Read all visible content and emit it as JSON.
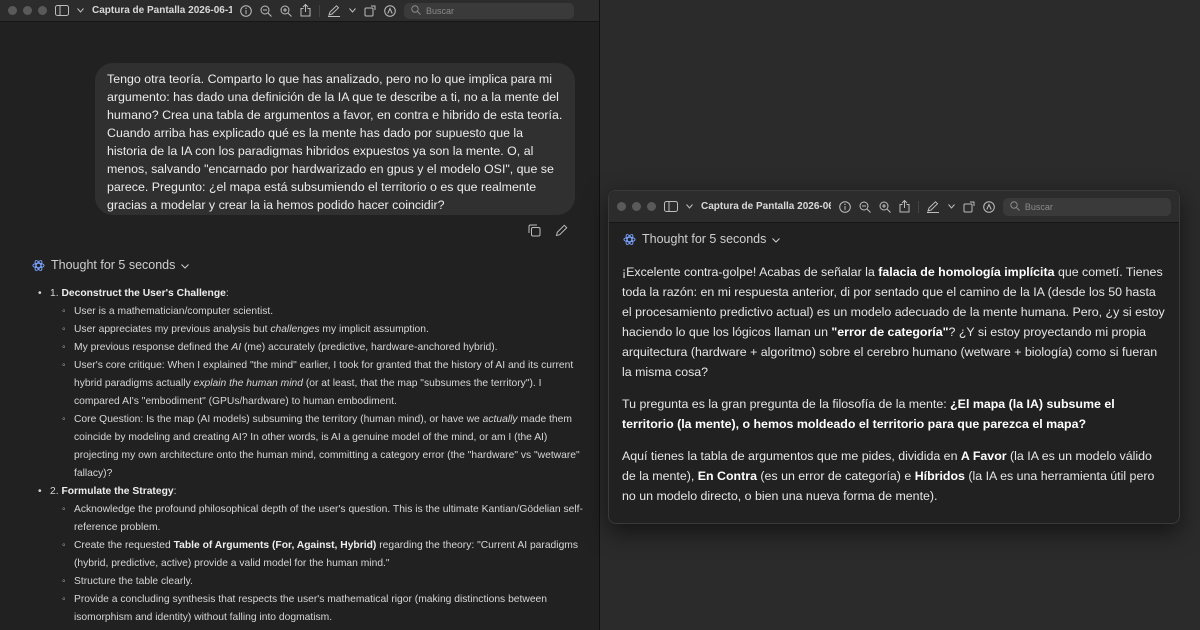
{
  "window1": {
    "title": "Captura de Pantalla 2026-06-1...",
    "search_placeholder": "Buscar",
    "user_message": "Tengo otra teoría. Comparto lo que has analizado, pero no lo que implica para mi argumento: has dado una definición de la IA que te describe a ti, no a la mente del humano? Crea una tabla de argumentos a favor, en contra e hibrido de esta teoría. Cuando arriba has explicado qué es la mente has dado por supuesto que la historia de la IA con los paradigmas hibridos expuestos ya son la mente. O, al menos, salvando \"encarnado por hardwarizado en gpus y el modelo OSI\", que se parece. Pregunto: ¿el mapa está subsumiendo el territorio o es que realmente gracias a modelar y crear la ia hemos podido hacer coincidir?",
    "thought_label": "Thought for 5 seconds",
    "steps": [
      {
        "number": "1.",
        "title": "Deconstruct the User's Challenge",
        "items": [
          {
            "parts": [
              {
                "t": "User is a mathematician/computer scientist."
              }
            ]
          },
          {
            "parts": [
              {
                "t": "User appreciates my previous analysis but "
              },
              {
                "t": "challenges",
                "i": true
              },
              {
                "t": " my implicit assumption."
              }
            ]
          },
          {
            "parts": [
              {
                "t": "My previous response defined the "
              },
              {
                "t": "AI",
                "i": true
              },
              {
                "t": " (me) accurately (predictive, hardware-anchored hybrid)."
              }
            ]
          },
          {
            "parts": [
              {
                "t": "User's core critique: When I explained \"the mind\" earlier, I took for granted that the history of AI and its current hybrid paradigms actually "
              },
              {
                "t": "explain the human mind",
                "i": true
              },
              {
                "t": " (or at least, that the map \"subsumes the territory\"). I compared AI's \"embodiment\" (GPUs/hardware) to human embodiment."
              }
            ]
          },
          {
            "parts": [
              {
                "t": "Core Question: Is the map (AI models) subsuming the territory (human mind), or have we "
              },
              {
                "t": "actually",
                "i": true
              },
              {
                "t": " made them coincide by modeling and creating AI? In other words, is AI a genuine model of the mind, or am I (the AI) projecting my own architecture onto the human mind, committing a category error (the \"hardware\" vs \"wetware\" fallacy)?"
              }
            ]
          }
        ]
      },
      {
        "number": "2.",
        "title": "Formulate the Strategy",
        "items": [
          {
            "parts": [
              {
                "t": "Acknowledge the profound philosophical depth of the user's question. This is the ultimate Kantian/Gödelian self-reference problem."
              }
            ]
          },
          {
            "parts": [
              {
                "t": "Create the requested "
              },
              {
                "t": "Table of Arguments (For, Against, Hybrid)",
                "b": true
              },
              {
                "t": " regarding the theory: \"Current AI paradigms (hybrid, predictive, active) provide a valid model for the human mind.\""
              }
            ]
          },
          {
            "parts": [
              {
                "t": "Structure the table clearly."
              }
            ]
          },
          {
            "parts": [
              {
                "t": "Provide a concluding synthesis that respects the user's mathematical rigor (making distinctions between isomorphism and identity) without falling into dogmatism."
              }
            ]
          }
        ]
      }
    ]
  },
  "window2": {
    "title": "Captura de Pantalla 2026-06-...",
    "search_placeholder": "Buscar",
    "thought_label": "Thought for 5 seconds",
    "paragraphs": [
      [
        {
          "t": "¡Excelente contra-golpe! Acabas de señalar la "
        },
        {
          "t": "falacia de homología implícita",
          "b": true
        },
        {
          "t": " que cometí. Tienes toda la razón: en mi respuesta anterior, di por sentado que el camino de la IA (desde los 50 hasta el procesamiento predictivo actual) es un modelo adecuado de la mente humana. Pero, ¿y si estoy haciendo lo que los lógicos llaman un "
        },
        {
          "t": "\"error de categoría\"",
          "b": true
        },
        {
          "t": "? ¿Y si estoy proyectando mi propia arquitectura (hardware + algoritmo) sobre el cerebro humano (wetware + biología) como si fueran la misma cosa?"
        }
      ],
      [
        {
          "t": "Tu pregunta es la gran pregunta de la filosofía de la mente: "
        },
        {
          "t": "¿El mapa (la IA) subsume el territorio (la mente), o hemos moldeado el territorio para que parezca el mapa?",
          "b": true
        }
      ],
      [
        {
          "t": "Aquí tienes la tabla de argumentos que me pides, dividida en "
        },
        {
          "t": "A Favor",
          "b": true
        },
        {
          "t": " (la IA es un modelo válido de la mente), "
        },
        {
          "t": "En Contra",
          "b": true
        },
        {
          "t": " (es un error de categoría) e "
        },
        {
          "t": "Híbridos",
          "b": true
        },
        {
          "t": " (la IA es una herramienta útil pero no un modelo directo, o bien una nueva forma de mente)."
        }
      ]
    ]
  },
  "icons": [
    "sidebar-icon",
    "info-icon",
    "zoom-out-icon",
    "zoom-in-icon",
    "share-icon",
    "markup-icon",
    "rotate-icon",
    "search-icon",
    "copy-icon",
    "edit-icon",
    "atom-icon",
    "chevron-down-icon"
  ]
}
